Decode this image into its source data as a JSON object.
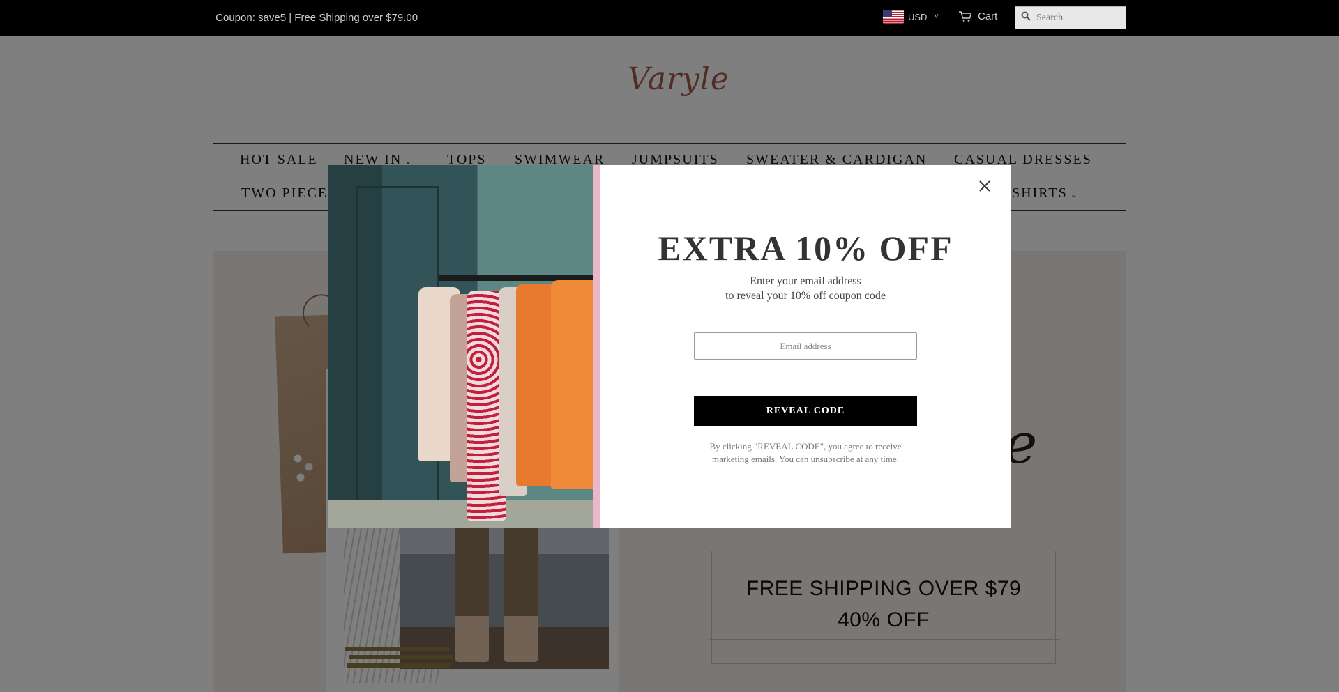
{
  "topbar": {
    "promo": " Coupon: save5 | Free Shipping over $79.00  ",
    "currency": "USD",
    "cart_label": "Cart",
    "search_placeholder": "Search"
  },
  "header": {
    "logo_text": "Varyle"
  },
  "nav": {
    "row1": [
      {
        "label": "HOT SALE",
        "has_caret": false
      },
      {
        "label": "NEW IN",
        "has_caret": true
      },
      {
        "label": "TOPS",
        "has_caret": false
      },
      {
        "label": "SWIMWEAR",
        "has_caret": false
      },
      {
        "label": "JUMPSUITS",
        "has_caret": false
      },
      {
        "label": "SWEATER & CARDIGAN",
        "has_caret": false
      },
      {
        "label": "CASUAL DRESSES",
        "has_caret": false
      }
    ],
    "row2_left": "TWO PIECE",
    "row2_right": "T-SHIRTS",
    "caret": "⌄"
  },
  "hero": {
    "promo_line1": "FREE SHIPPING OVER $79",
    "promo_line2": "40% OFF",
    "script_fragment": "e"
  },
  "modal": {
    "title": "EXTRA 10% OFF",
    "subtitle_line1": "Enter your email address",
    "subtitle_line2": "to reveal your 10% off coupon code",
    "email_placeholder": "Email address",
    "button_label": "REVEAL CODE",
    "legal_text": "By clicking \"REVEAL CODE\", you agree to receive marketing emails. You can unsubscribe at any time."
  },
  "icons": {
    "search": "search-icon",
    "cart": "cart-icon",
    "close": "close-icon",
    "chevron": "chevron-down-icon",
    "flag": "us-flag-icon"
  },
  "colors": {
    "topbar_bg": "#000000",
    "logo": "#a45a4a",
    "button_bg": "#000000",
    "hero_bg": "#f3ece7"
  }
}
